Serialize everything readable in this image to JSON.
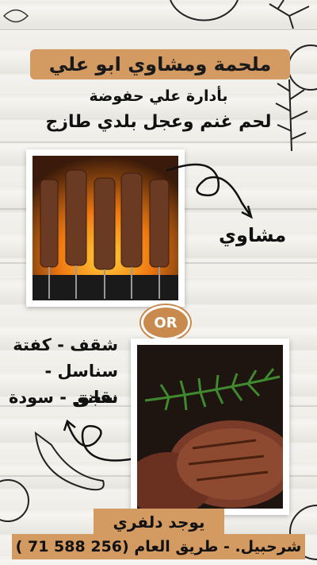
{
  "header": {
    "title": "ملحمة ومشاوي ابو علي",
    "management": "بأدارة علي حفوضة",
    "meat": "لحم غنم وعجل بلدي طازج"
  },
  "grill_section": {
    "label": "مشاوي"
  },
  "or_badge": "OR",
  "menu": {
    "items": [
      "شقف - كفتة",
      "سناسل - سجق",
      "نقانق - سودة"
    ]
  },
  "footer": {
    "delivery": "يوجد دلفري",
    "address": "شرحبيل. - طريق العام (256 588 71 )"
  },
  "colors": {
    "accent": "#d39a62",
    "badge": "#c98a4e",
    "text": "#111111"
  }
}
